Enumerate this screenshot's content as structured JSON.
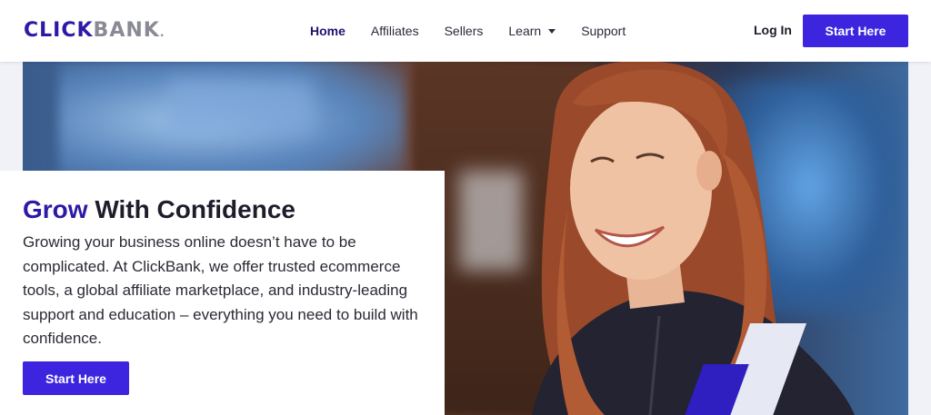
{
  "brand": {
    "logo_part1": "CLICK",
    "logo_part2": "BANK",
    "logo_mark": "."
  },
  "nav": {
    "items": [
      {
        "label": "Home",
        "active": true
      },
      {
        "label": "Affiliates"
      },
      {
        "label": "Sellers"
      },
      {
        "label": "Learn",
        "dropdown": true
      },
      {
        "label": "Support"
      }
    ],
    "login_label": "Log In",
    "cta_label": "Start Here"
  },
  "hero": {
    "title_strong": "Grow",
    "title_rest": " With Confidence",
    "body": "Growing your business online doesn’t have to be complicated. At ClickBank, we offer trusted ecommerce tools, a global affiliate marketplace, and industry-leading support and education – everything you need to build with confidence.",
    "cta_label": "Start Here"
  },
  "colors": {
    "brand_primary": "#3d25e0",
    "brand_dark": "#2c1aa6",
    "page_background": "#f1f2f8",
    "slash_light": "#e6e8f4"
  }
}
